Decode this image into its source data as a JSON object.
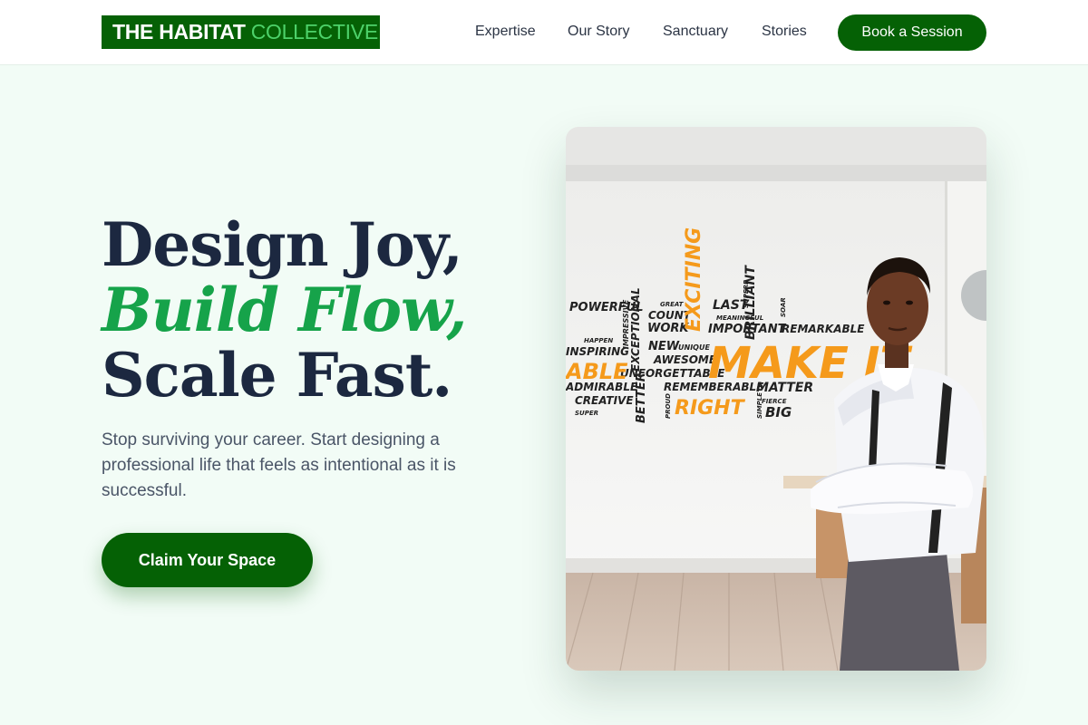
{
  "brand": {
    "strong": "THE HABITAT",
    "light": "COLLECTIVE"
  },
  "nav": {
    "items": [
      "Expertise",
      "Our Story",
      "Sanctuary",
      "Stories"
    ],
    "cta": "Book a Session"
  },
  "hero": {
    "headline": [
      "Design Joy,",
      "Build Flow,",
      "Scale Fast."
    ],
    "subtext": "Stop surviving your career. Start designing a professional life that feels as intentional as it is successful.",
    "cta": "Claim Your Space",
    "image": {
      "wall_words": [
        "POWERFUL",
        "GREAT",
        "LAST",
        "SUPERB",
        "BRILLIANT",
        "SOAR",
        "COUNT",
        "MEANINGFUL",
        "WORK",
        "IMPORTANT",
        "REMARKABLE",
        "EXCITING",
        "HAPPEN",
        "IMPRESSIVE",
        "EXCEPTIONAL",
        "INSPIRING",
        "NEW",
        "UNIQUE",
        "AWESOME",
        "ABLE",
        "UNFORGETTABLE",
        "MAKE IT",
        "ADMIRABLE",
        "BETTER",
        "REMEMBERABLE",
        "MATTER",
        "CREATIVE",
        "PROUD",
        "RIGHT",
        "SIMPLE",
        "FIERCE",
        "SUPER",
        "BIG"
      ]
    }
  },
  "colors": {
    "primary": "#056105",
    "accent": "#16a34a",
    "heading": "#1c2840",
    "background": "#f2fcf6",
    "wall_orange": "#f59a1b"
  }
}
